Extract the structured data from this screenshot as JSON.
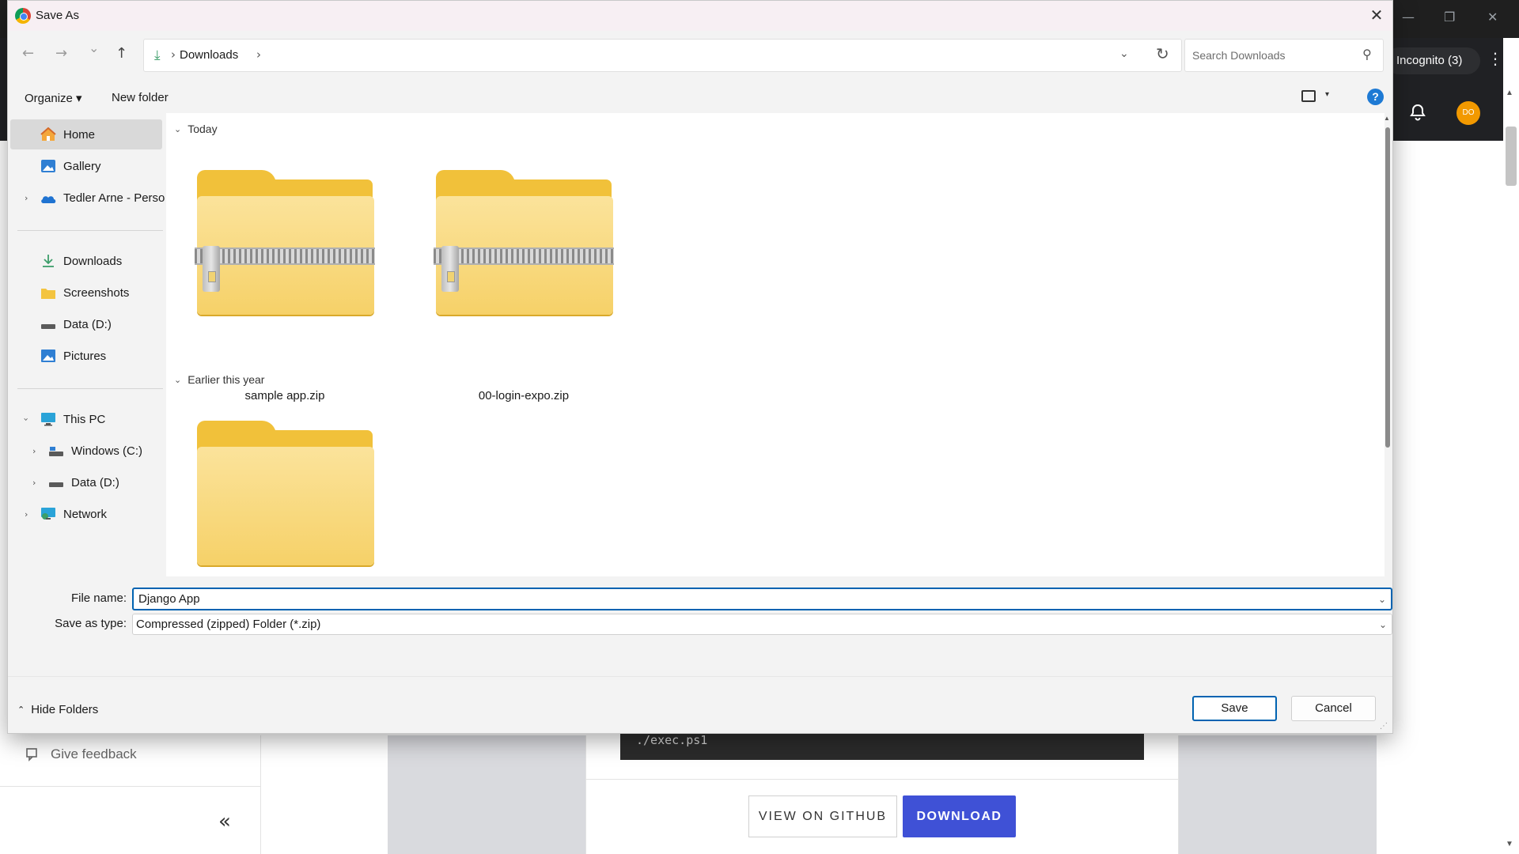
{
  "dialog": {
    "title": "Save As",
    "close_glyph": "✕"
  },
  "nav": {
    "back_glyph": "←",
    "forward_glyph": "→",
    "recent_glyph": "⌄",
    "up_glyph": "↑",
    "path_separator": "›",
    "location": "Downloads",
    "address_dropdown_glyph": "⌄",
    "refresh_glyph": "↻",
    "search_placeholder": "Search Downloads",
    "search_glyph": "⚲"
  },
  "commandbar": {
    "organize_label": "Organize ▾",
    "new_folder_label": "New folder",
    "view_caret": "▾",
    "help_label": "?"
  },
  "navpane": {
    "items": [
      {
        "label": "Home",
        "icon": "home-icon"
      },
      {
        "label": "Gallery",
        "icon": "gallery-icon"
      },
      {
        "label": "Tedler Arne - Personal",
        "icon": "onedrive-icon"
      },
      {
        "label": "Downloads",
        "icon": "download-icon"
      },
      {
        "label": "Screenshots",
        "icon": "folder-icon"
      },
      {
        "label": "Data (D:)",
        "icon": "drive-icon"
      },
      {
        "label": "Pictures",
        "icon": "pictures-icon"
      },
      {
        "label": "This PC",
        "icon": "computer-icon"
      },
      {
        "label": "Windows (C:)",
        "icon": "drive-icon"
      },
      {
        "label": "Data (D:)",
        "icon": "drive-icon"
      },
      {
        "label": "Network",
        "icon": "network-icon"
      }
    ],
    "selected": "Home"
  },
  "content": {
    "groups": [
      {
        "name": "Today",
        "files": [
          {
            "name": "sample app.zip",
            "type": "zip"
          },
          {
            "name": "00-login-expo.zip",
            "type": "zip"
          }
        ]
      },
      {
        "name": "Earlier this year",
        "files": [
          {
            "name": "",
            "type": "folder"
          }
        ]
      }
    ]
  },
  "fields": {
    "filename_label": "File name:",
    "filename_value": "Django App",
    "savetype_label": "Save as type:",
    "savetype_value": "Compressed (zipped) Folder (*.zip)"
  },
  "footer": {
    "hide_folders_label": "Hide Folders",
    "save_label": "Save",
    "cancel_label": "Cancel"
  },
  "background": {
    "incognito_label": "Incognito (3)",
    "avatar_initials": "DO",
    "give_feedback_label": "Give feedback",
    "collapse_glyph": "«",
    "code_text": "./exec.ps1",
    "view_github_label": "VIEW ON GITHUB",
    "download_label": "DOWNLOAD",
    "kebab_glyph": "⋮",
    "minimize_glyph": "—",
    "restore_glyph": "❐",
    "close_glyph": "✕"
  },
  "colors": {
    "accent": "#0063b1",
    "download_button": "#3f51d6",
    "folder_yellow": "#f1c13a",
    "help_blue": "#1e7ad4"
  }
}
